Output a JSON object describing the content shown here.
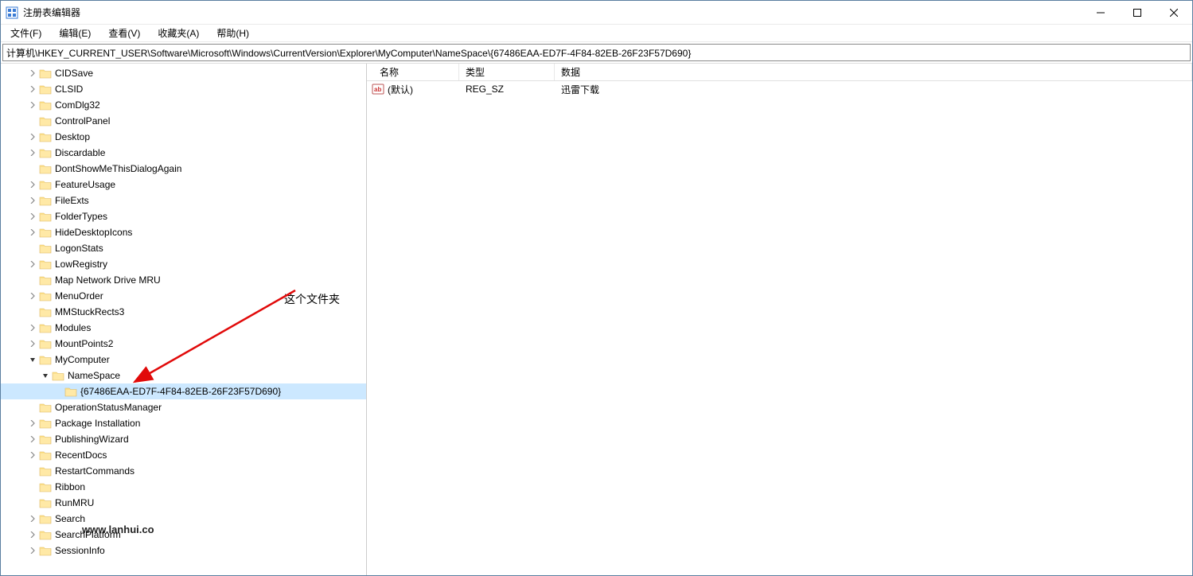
{
  "window": {
    "title": "注册表编辑器"
  },
  "menu": {
    "file": "文件(F)",
    "edit": "编辑(E)",
    "view": "查看(V)",
    "favorites": "收藏夹(A)",
    "help": "帮助(H)"
  },
  "address": "计算机\\HKEY_CURRENT_USER\\Software\\Microsoft\\Windows\\CurrentVersion\\Explorer\\MyComputer\\NameSpace\\{67486EAA-ED7F-4F84-82EB-26F23F57D690}",
  "tree": {
    "items": [
      {
        "label": "CIDSave",
        "indent": 2,
        "expander": "closed"
      },
      {
        "label": "CLSID",
        "indent": 2,
        "expander": "closed"
      },
      {
        "label": "ComDlg32",
        "indent": 2,
        "expander": "closed"
      },
      {
        "label": "ControlPanel",
        "indent": 2,
        "expander": "none"
      },
      {
        "label": "Desktop",
        "indent": 2,
        "expander": "closed"
      },
      {
        "label": "Discardable",
        "indent": 2,
        "expander": "closed"
      },
      {
        "label": "DontShowMeThisDialogAgain",
        "indent": 2,
        "expander": "none"
      },
      {
        "label": "FeatureUsage",
        "indent": 2,
        "expander": "closed"
      },
      {
        "label": "FileExts",
        "indent": 2,
        "expander": "closed"
      },
      {
        "label": "FolderTypes",
        "indent": 2,
        "expander": "closed"
      },
      {
        "label": "HideDesktopIcons",
        "indent": 2,
        "expander": "closed"
      },
      {
        "label": "LogonStats",
        "indent": 2,
        "expander": "none"
      },
      {
        "label": "LowRegistry",
        "indent": 2,
        "expander": "closed"
      },
      {
        "label": "Map Network Drive MRU",
        "indent": 2,
        "expander": "none"
      },
      {
        "label": "MenuOrder",
        "indent": 2,
        "expander": "closed"
      },
      {
        "label": "MMStuckRects3",
        "indent": 2,
        "expander": "none"
      },
      {
        "label": "Modules",
        "indent": 2,
        "expander": "closed"
      },
      {
        "label": "MountPoints2",
        "indent": 2,
        "expander": "closed"
      },
      {
        "label": "MyComputer",
        "indent": 2,
        "expander": "open"
      },
      {
        "label": "NameSpace",
        "indent": 3,
        "expander": "open"
      },
      {
        "label": "{67486EAA-ED7F-4F84-82EB-26F23F57D690}",
        "indent": 4,
        "expander": "none",
        "selected": true
      },
      {
        "label": "OperationStatusManager",
        "indent": 2,
        "expander": "none"
      },
      {
        "label": "Package Installation",
        "indent": 2,
        "expander": "closed"
      },
      {
        "label": "PublishingWizard",
        "indent": 2,
        "expander": "closed"
      },
      {
        "label": "RecentDocs",
        "indent": 2,
        "expander": "closed"
      },
      {
        "label": "RestartCommands",
        "indent": 2,
        "expander": "none"
      },
      {
        "label": "Ribbon",
        "indent": 2,
        "expander": "none"
      },
      {
        "label": "RunMRU",
        "indent": 2,
        "expander": "none"
      },
      {
        "label": "Search",
        "indent": 2,
        "expander": "closed"
      },
      {
        "label": "SearchPlatform",
        "indent": 2,
        "expander": "closed"
      },
      {
        "label": "SessionInfo",
        "indent": 2,
        "expander": "closed"
      }
    ]
  },
  "list": {
    "columns": {
      "name": "名称",
      "type": "类型",
      "data": "数据"
    },
    "rows": [
      {
        "name": "(默认)",
        "type": "REG_SZ",
        "data": "迅雷下载"
      }
    ]
  },
  "annotation": {
    "text": "这个文件夹"
  },
  "watermark": "www.lanhui.co"
}
